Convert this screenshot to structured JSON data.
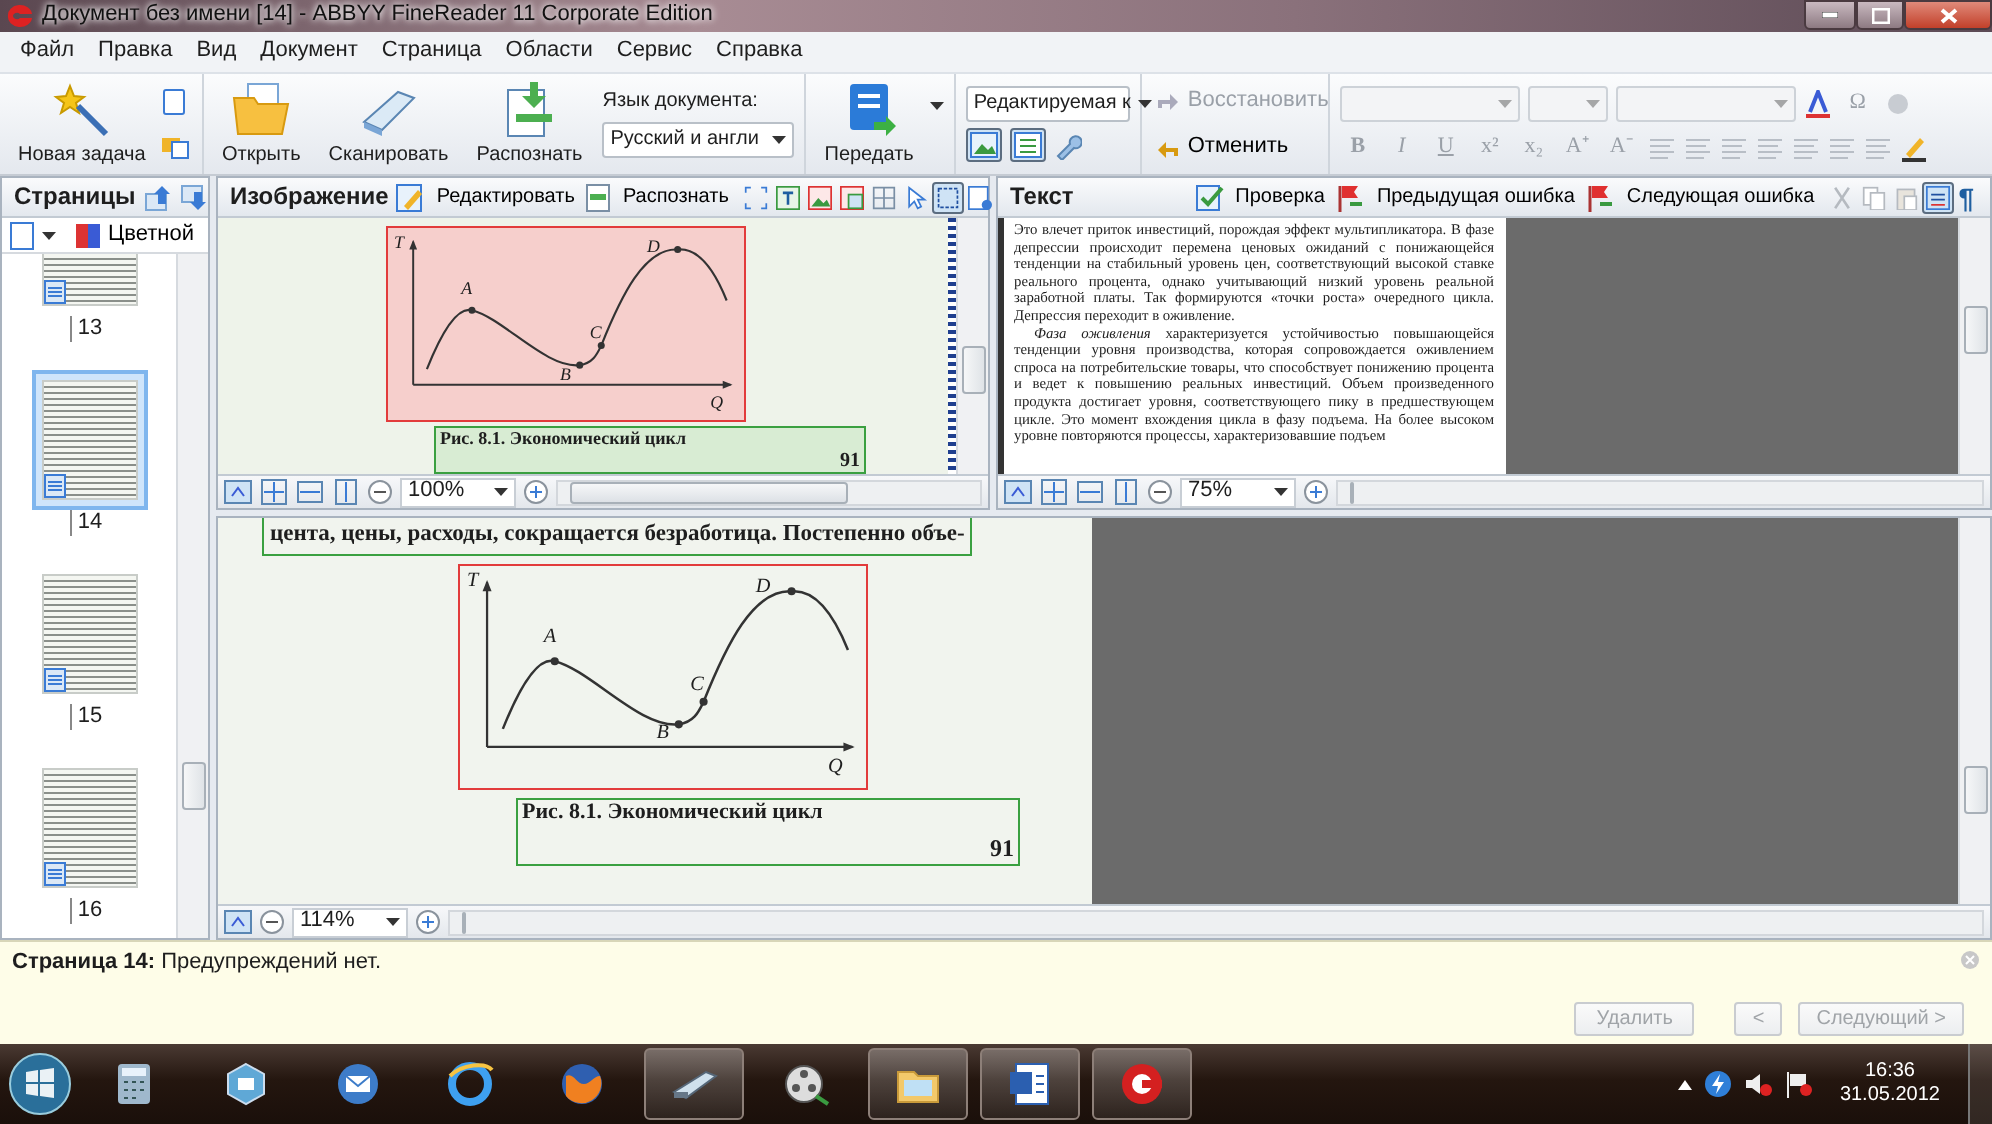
{
  "window": {
    "title": "Документ без имени [14] - ABBYY FineReader 11 Corporate Edition"
  },
  "menu": [
    "Файл",
    "Правка",
    "Вид",
    "Документ",
    "Страница",
    "Области",
    "Сервис",
    "Справка"
  ],
  "toolbar": {
    "new_task": "Новая задача",
    "open": "Открыть",
    "scan": "Сканировать",
    "recognize": "Распознать",
    "language": {
      "label": "Язык документа:",
      "value": "Русский и англи"
    },
    "send": "Передать",
    "mode": {
      "value": "Редактируемая к"
    },
    "view_toggles": [
      {
        "kind": "image",
        "selected": true
      },
      {
        "kind": "text",
        "selected": true
      }
    ],
    "redo": {
      "label": "Восстановить",
      "disabled": true
    },
    "undo": {
      "label": "Отменить",
      "disabled": false
    },
    "format_buttons": [
      "B",
      "I",
      "U",
      "x²",
      "x₂",
      "A⁺",
      "A⁻"
    ],
    "symbol": "Ω"
  },
  "pages_panel": {
    "title": "Страницы",
    "color_mode": "Цветной",
    "pages": [
      {
        "number": "13",
        "selected": false
      },
      {
        "number": "14",
        "selected": true
      },
      {
        "number": "15",
        "selected": false
      },
      {
        "number": "16",
        "selected": false
      }
    ]
  },
  "image_pane": {
    "title": "Изображение",
    "actions": [
      "Редактировать",
      "Распознать"
    ],
    "tools": [
      {
        "kind": "area",
        "selected": false
      },
      {
        "kind": "text",
        "selected": false
      },
      {
        "kind": "picture",
        "selected": false
      },
      {
        "kind": "background",
        "selected": false
      },
      {
        "kind": "table",
        "selected": false
      },
      {
        "kind": "pointer",
        "selected": false
      },
      {
        "kind": "select",
        "selected": true
      },
      {
        "kind": "erase",
        "selected": false
      }
    ],
    "figure": {
      "labels": [
        "T",
        "A",
        "B",
        "C",
        "D",
        "Q"
      ]
    },
    "caption": "Рис. 8.1. Экономический цикл",
    "page_number": "91",
    "zoom": "100%"
  },
  "text_pane": {
    "title": "Текст",
    "actions": [
      "Проверка",
      "Предыдущая ошибка",
      "Следующая ошибка"
    ],
    "tools": [
      {
        "kind": "cut",
        "selected": false
      },
      {
        "kind": "copy",
        "selected": false
      },
      {
        "kind": "paste",
        "selected": false
      },
      {
        "kind": "highlight",
        "selected": true
      },
      {
        "kind": "marks",
        "label": "¶",
        "selected": false
      }
    ],
    "paragraphs": [
      {
        "indent": false,
        "text": "Это влечет приток инвестиций, порождая эффект мультипликатора. В фазе депрессии происходит перемена ценовых ожиданий с понижающейся тенденции на стабильный уровень цен, соответствующий высокой ставке реального процента, однако учитывающий низкий уровень реальной заработной платы. Так формируются «точки роста» очередного цикла. Депрессия переходит в оживление."
      },
      {
        "indent": true,
        "text": "*Фаза оживления* характеризуется устойчивостью повышающейся тенденции уровня производства, которая сопровождается оживлением спроса на потребительские товары, что способствует понижению процента и ведет к повышению реальных инвестиций. Объем произведенного продукта достигает уровня, соответствующего пику в предшествующем цикле. Это момент вхождения цикла в фазу подъема. На более высоком уровне повторяются процессы, характеризовавшие подъем"
      }
    ],
    "zoom": "75%"
  },
  "zoom_pane": {
    "text_line": "цента, цены, расходы, сокращается безработица. Постепенно объе-",
    "figure": {
      "labels": [
        "T",
        "A",
        "B",
        "C",
        "D",
        "Q"
      ]
    },
    "caption": "Рис. 8.1. Экономический цикл",
    "page_number": "91",
    "zoom": "114%"
  },
  "warning_panel": {
    "message": "**Страница 14:** Предупреждений нет.",
    "buttons": [
      {
        "label": "Удалить",
        "disabled": true
      },
      {
        "label": "<",
        "disabled": true
      },
      {
        "label": "Следующий >",
        "disabled": true
      }
    ]
  },
  "taskbar": {
    "apps": [
      {
        "kind": "calculator",
        "running": false
      },
      {
        "kind": "network",
        "running": false
      },
      {
        "kind": "mail",
        "running": false
      },
      {
        "kind": "browser",
        "running": false
      },
      {
        "kind": "globe",
        "running": false
      },
      {
        "kind": "scanner",
        "running": true
      },
      {
        "kind": "film",
        "running": false
      },
      {
        "kind": "folder",
        "running": true
      },
      {
        "kind": "document",
        "running": true
      },
      {
        "kind": "reader",
        "running": true
      }
    ],
    "time": "16:36",
    "date": "31.05.2012"
  }
}
